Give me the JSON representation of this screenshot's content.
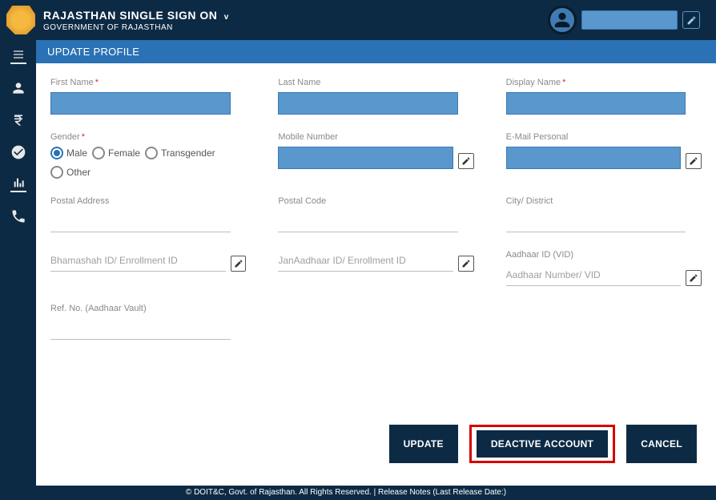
{
  "header": {
    "title": "RAJASTHAN SINGLE SIGN ON",
    "subtitle": "GOVERNMENT OF RAJASTHAN"
  },
  "panel": {
    "title": "UPDATE PROFILE"
  },
  "labels": {
    "first_name": "First Name",
    "last_name": "Last Name",
    "display_name": "Display Name",
    "gender": "Gender",
    "mobile": "Mobile Number",
    "email": "E-Mail Personal",
    "postal_address": "Postal Address",
    "postal_code": "Postal Code",
    "city": "City/ District",
    "bhamashah": "Bhamashah ID/ Enrollment ID",
    "janaadhaar": "JanAadhaar ID/ Enrollment ID",
    "aadhaar_vid": "Aadhaar ID (VID)",
    "aadhaar_placeholder": "Aadhaar Number/ VID",
    "ref_no": "Ref. No. (Aadhaar Vault)"
  },
  "gender_options": {
    "male": "Male",
    "female": "Female",
    "transgender": "Transgender",
    "other": "Other"
  },
  "gender_selected": "male",
  "buttons": {
    "update": "UPDATE",
    "deactive": "DEACTIVE ACCOUNT",
    "cancel": "CANCEL"
  },
  "footer": "© DOIT&C, Govt. of Rajasthan. All Rights Reserved.  |  Release Notes (Last Release Date:)"
}
